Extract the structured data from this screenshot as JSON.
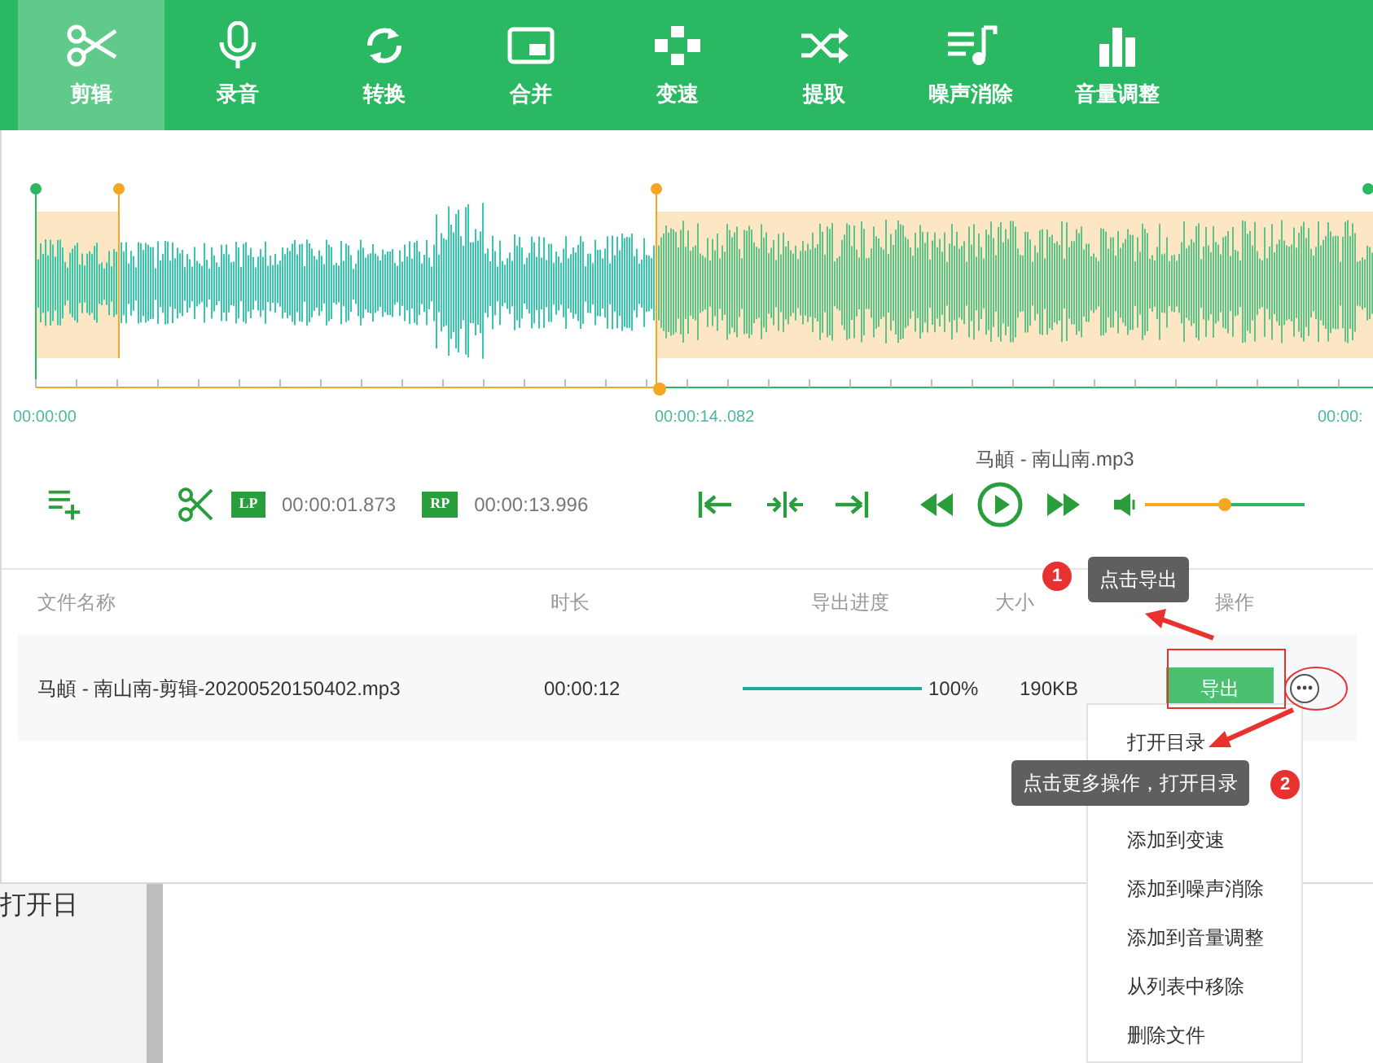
{
  "toolbar": {
    "tabs": [
      {
        "label": "剪辑",
        "selected": true
      },
      {
        "label": "录音",
        "selected": false
      },
      {
        "label": "转换",
        "selected": false
      },
      {
        "label": "合并",
        "selected": false
      },
      {
        "label": "变速",
        "selected": false
      },
      {
        "label": "提取",
        "selected": false
      },
      {
        "label": "噪声消除",
        "selected": false
      },
      {
        "label": "音量调整",
        "selected": false
      }
    ]
  },
  "timeline": {
    "labels": [
      "00:00:00",
      "00:00:14..082",
      "00:00:"
    ]
  },
  "player": {
    "file_name": "马頔 - 南山南.mp3",
    "lp_badge": "LP",
    "lp_time": "00:00:01.873",
    "rp_badge": "RP",
    "rp_time": "00:00:13.996",
    "volume": {
      "level": 0.5
    }
  },
  "table": {
    "columns": [
      "文件名称",
      "时长",
      "导出进度",
      "大小",
      "操作"
    ],
    "rows": [
      {
        "file_name": "马頔 - 南山南-剪辑-20200520150402.mp3",
        "duration": "00:00:12",
        "progress": {
          "level": 1
        },
        "progress_text": "100%",
        "size": "190KB",
        "action": "导出"
      }
    ]
  },
  "context_menu": {
    "items": [
      "打开目录",
      "添加到变速",
      "添加到噪声消除",
      "添加到音量调整",
      "从列表中移除",
      "删除文件"
    ]
  },
  "annotations": [
    {
      "number": "1",
      "text": "点击导出"
    },
    {
      "number": "2",
      "text": "点击更多操作，打开目录"
    }
  ],
  "background_text": "打开日"
}
